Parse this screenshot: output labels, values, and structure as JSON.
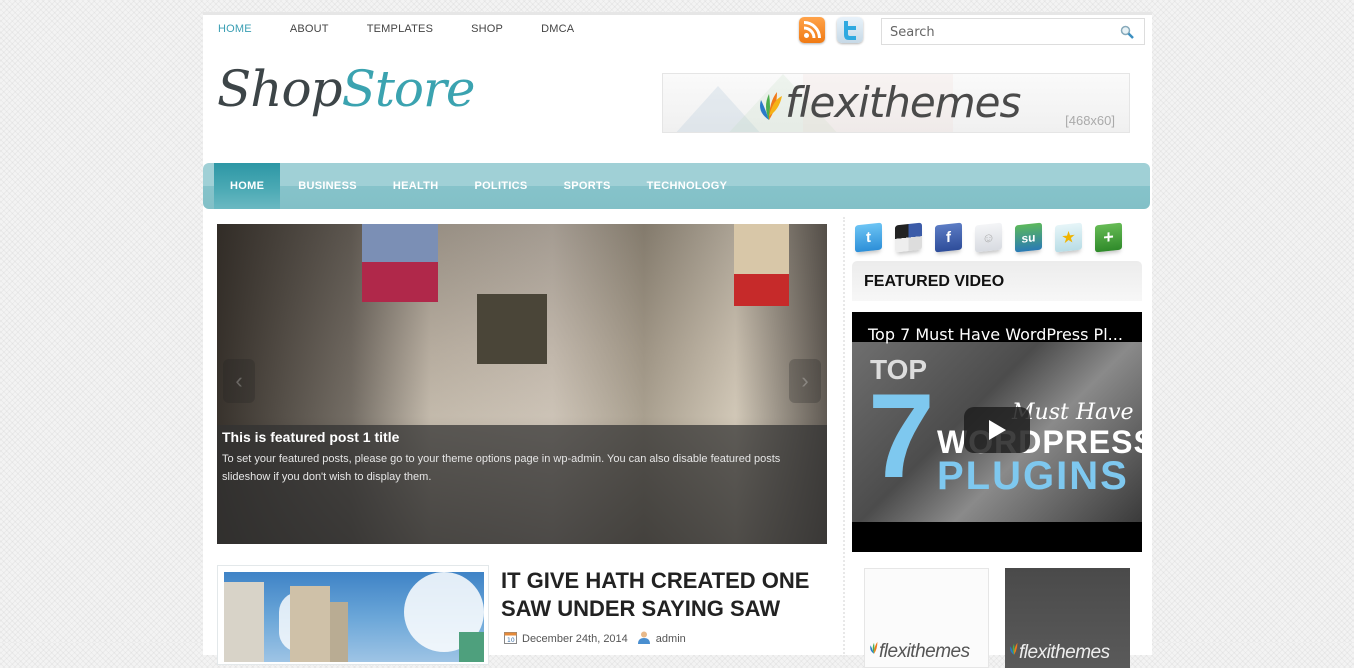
{
  "top_nav": {
    "items": [
      {
        "label": "HOME",
        "active": true
      },
      {
        "label": "ABOUT",
        "active": false
      },
      {
        "label": "TEMPLATES",
        "active": false
      },
      {
        "label": "SHOP",
        "active": false
      },
      {
        "label": "DMCA",
        "active": false
      }
    ]
  },
  "header_icons": [
    "rss-icon",
    "twitter-icon"
  ],
  "search": {
    "placeholder": "Search",
    "value": ""
  },
  "logo": {
    "part1": "Shop",
    "part2": "Store"
  },
  "banner": {
    "brand": "flexithemes",
    "size_label": "[468x60]"
  },
  "main_nav": {
    "items": [
      {
        "label": "HOME",
        "active": true
      },
      {
        "label": "BUSINESS",
        "active": false
      },
      {
        "label": "HEALTH",
        "active": false
      },
      {
        "label": "POLITICS",
        "active": false
      },
      {
        "label": "SPORTS",
        "active": false
      },
      {
        "label": "TECHNOLOGY",
        "active": false
      }
    ]
  },
  "slider": {
    "title": "This is featured post 1 title",
    "text": "To set your featured posts, please go to your theme options page in wp-admin. You can also disable featured posts slideshow if you don't wish to display them.",
    "prev_icon": "‹",
    "next_icon": "›"
  },
  "post": {
    "title": "IT GIVE HATH CREATED ONE SAW UNDER SAYING SAW",
    "date": "December 24th, 2014",
    "author": "admin"
  },
  "sidebar": {
    "social": [
      {
        "name": "twitter",
        "glyph": "t",
        "color": "#3aa3e3"
      },
      {
        "name": "delicious",
        "glyph": "",
        "color": "#3b5ba8"
      },
      {
        "name": "facebook",
        "glyph": "f",
        "color": "#3b5998"
      },
      {
        "name": "myspace",
        "glyph": "☺",
        "color": "#e4e6ea"
      },
      {
        "name": "stumbleupon",
        "glyph": "su",
        "color": "#3f9a3f"
      },
      {
        "name": "favorites",
        "glyph": "★",
        "color": "#bfe4ec"
      },
      {
        "name": "addthis",
        "glyph": "+",
        "color": "#4aa33b"
      }
    ],
    "featured_video": {
      "heading": "FEATURED VIDEO",
      "video_title": "Top 7 Must Have WordPress Pl...",
      "thumb_top": "TOP",
      "thumb_seven": "7",
      "thumb_must": "Must Have",
      "thumb_wp": "WORDPRESS",
      "thumb_plugins": "PLUGINS"
    },
    "ads": [
      {
        "brand": "flexithemes",
        "theme": "light"
      },
      {
        "brand": "flexithemes",
        "theme": "dark"
      }
    ]
  }
}
